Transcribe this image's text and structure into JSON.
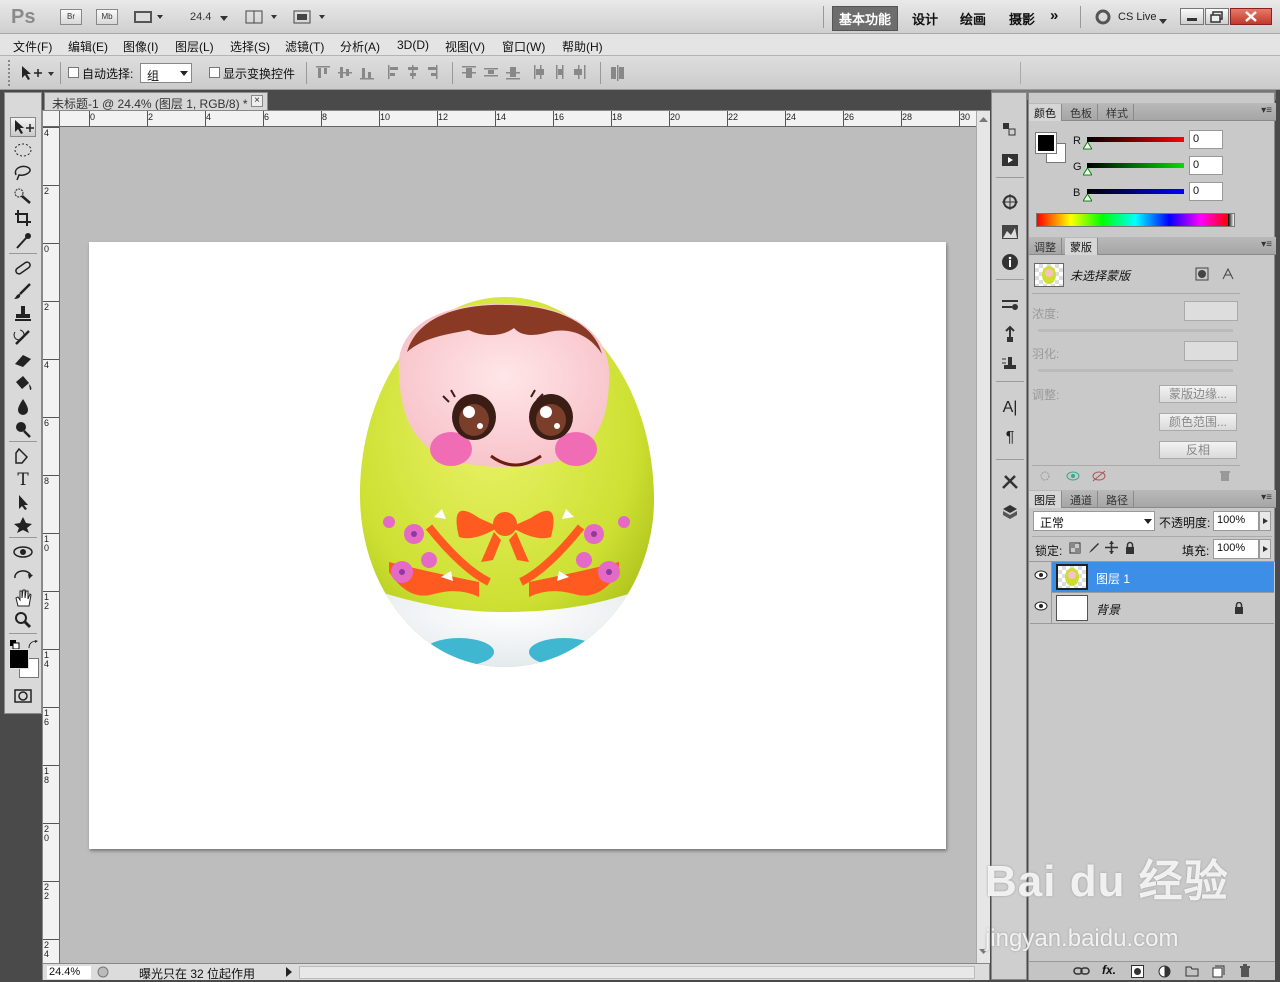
{
  "app": {
    "logo": "Ps",
    "br_label": "Br",
    "mb_label": "Mb",
    "zoom_value": "24.4",
    "cslive": "CS Live",
    "workspaces": [
      "基本功能",
      "设计",
      "绘画",
      "摄影"
    ],
    "more": "»"
  },
  "menu": [
    "文件(F)",
    "编辑(E)",
    "图像(I)",
    "图层(L)",
    "选择(S)",
    "滤镜(T)",
    "分析(A)",
    "3D(D)",
    "视图(V)",
    "窗口(W)",
    "帮助(H)"
  ],
  "options": {
    "auto_select_label": "自动选择:",
    "auto_select_value": "组",
    "show_transform_label": "显示变换控件"
  },
  "document": {
    "tab_title": "未标题-1 @ 24.4% (图层 1, RGB/8) *",
    "close": "×",
    "zoom_status": "24.4%",
    "status_text": "曝光只在 32 位起作用",
    "hruler_labels": [
      "0",
      "2",
      "4",
      "6",
      "8",
      "10",
      "12",
      "14",
      "16",
      "18",
      "20",
      "22",
      "24",
      "26",
      "28",
      "30"
    ],
    "vruler_labels": [
      "4",
      "2",
      "0",
      "2",
      "4",
      "6",
      "8",
      "10",
      "12",
      "14",
      "16",
      "18",
      "20",
      "22",
      "24"
    ]
  },
  "color_panel": {
    "tabs": [
      "颜色",
      "色板",
      "样式"
    ],
    "channels": [
      {
        "label": "R",
        "value": "0",
        "color": "#cc0000"
      },
      {
        "label": "G",
        "value": "0",
        "color": "#00aa00"
      },
      {
        "label": "B",
        "value": "0",
        "color": "#0000cc"
      }
    ]
  },
  "masks_panel": {
    "tabs": [
      "调整",
      "蒙版"
    ],
    "no_mask": "未选择蒙版",
    "density_label": "浓度:",
    "feather_label": "羽化:",
    "refine_label": "调整:",
    "buttons": [
      "蒙版边缘...",
      "颜色范围...",
      "反相"
    ]
  },
  "layers_panel": {
    "tabs": [
      "图层",
      "通道",
      "路径"
    ],
    "blend_mode": "正常",
    "opacity_label": "不透明度:",
    "opacity_value": "100%",
    "lock_label": "锁定:",
    "fill_label": "填充:",
    "fill_value": "100%",
    "layers": [
      {
        "name": "图层 1",
        "selected": true
      },
      {
        "name": "背景",
        "selected": false,
        "locked": true
      }
    ],
    "footer_icons": [
      "link-icon",
      "fx-icon",
      "mask-icon",
      "adjustment-icon",
      "group-icon",
      "new-layer-icon",
      "trash-icon"
    ],
    "fx_label": "fx."
  },
  "watermark": {
    "brand": "Bai du 经验",
    "url": "jingyan.baidu.com"
  }
}
